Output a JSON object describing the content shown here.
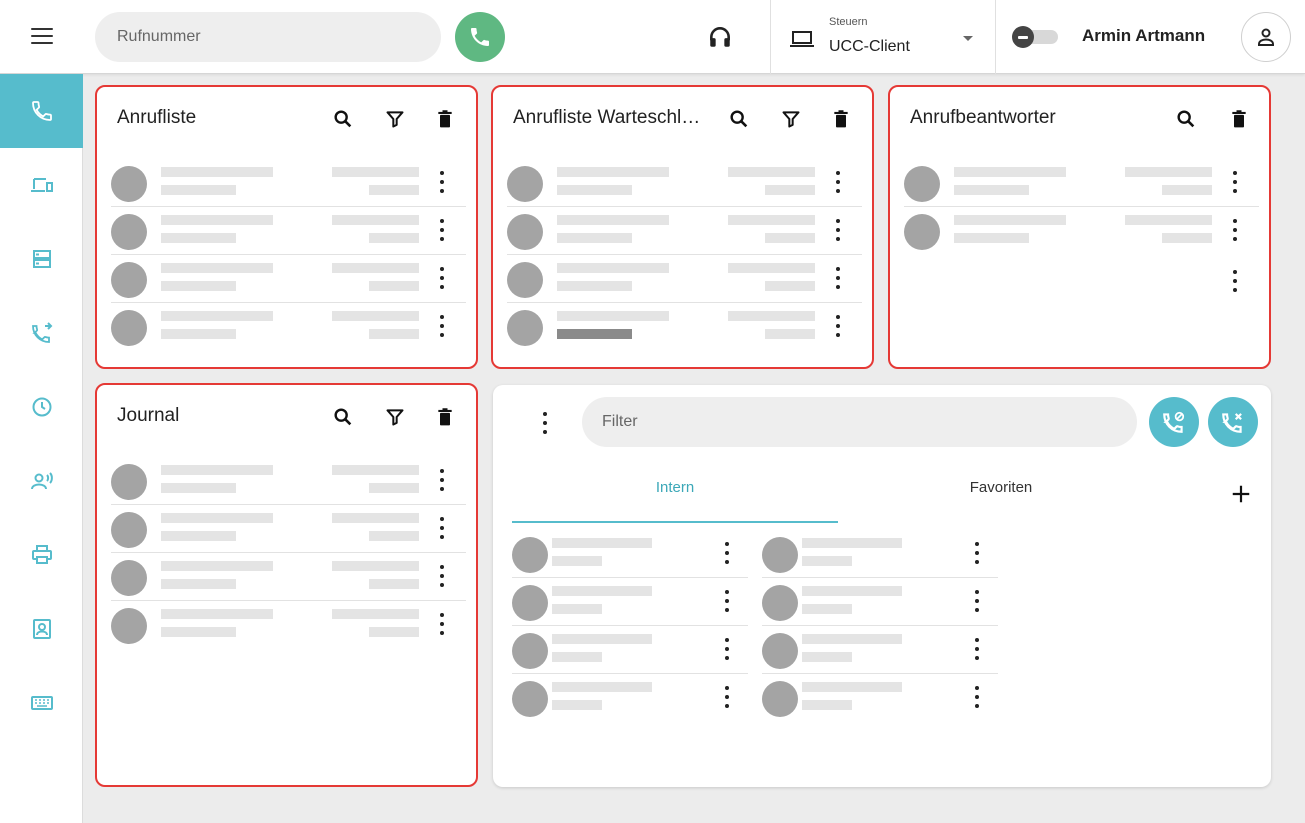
{
  "header": {
    "phone_placeholder": "Rufnummer",
    "device_label": "Steuern",
    "device_value": "UCC-Client",
    "user_name": "Armin Artmann"
  },
  "sidebar": {
    "items": [
      {
        "icon": "phone-icon",
        "active": true
      },
      {
        "icon": "devices-icon",
        "active": false
      },
      {
        "icon": "server-icon",
        "active": false
      },
      {
        "icon": "call-forward-icon",
        "active": false
      },
      {
        "icon": "clock-icon",
        "active": false
      },
      {
        "icon": "voice-icon",
        "active": false
      },
      {
        "icon": "printer-icon",
        "active": false
      },
      {
        "icon": "contact-card-icon",
        "active": false
      },
      {
        "icon": "keyboard-icon",
        "active": false
      }
    ]
  },
  "cards": {
    "anrufliste": {
      "title": "Anrufliste"
    },
    "warteschlange": {
      "title": "Anrufliste Warteschlange"
    },
    "anrufbeantworter": {
      "title": "Anrufbeantworter"
    },
    "journal": {
      "title": "Journal"
    }
  },
  "contacts": {
    "filter_placeholder": "Filter",
    "tabs": [
      "Intern",
      "Favoriten"
    ]
  },
  "colors": {
    "accent": "#56bccc",
    "call_green": "#5fb882",
    "highlight_border": "#e53935"
  }
}
